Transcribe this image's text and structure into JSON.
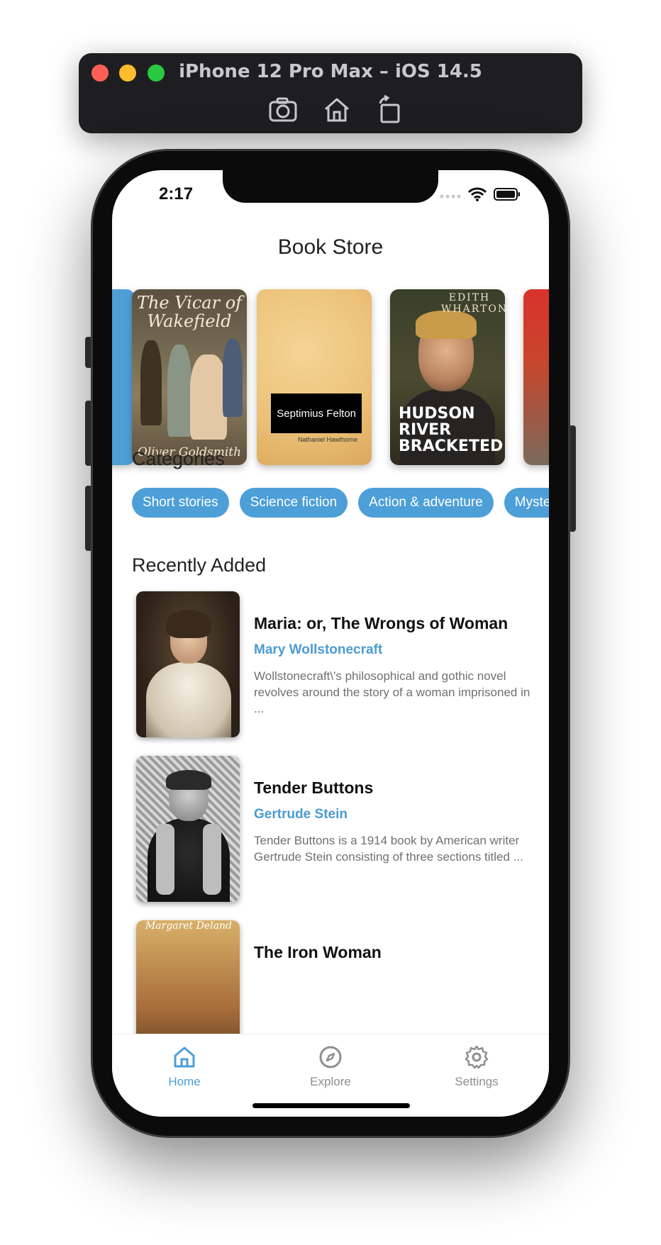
{
  "simulator": {
    "title": "iPhone 12 Pro Max – iOS 14.5",
    "tools": [
      "camera-icon",
      "home-icon",
      "rotate-icon"
    ]
  },
  "status_bar": {
    "time": "2:17"
  },
  "app": {
    "title": "Book Store"
  },
  "featured": [
    {
      "id": "vicar",
      "cover_title": "The Vicar of Wakefield",
      "cover_author": "Oliver Goldsmith"
    },
    {
      "id": "septimius",
      "cover_title": "Septimius Felton",
      "cover_author": "Nathaniel Hawthorne"
    },
    {
      "id": "hudson",
      "cover_author": "EDITH WHARTON",
      "cover_title": "HUDSON RIVER BRACKETED"
    }
  ],
  "categories": {
    "title": "Categories",
    "chips": [
      "Short stories",
      "Science fiction",
      "Action & adventure",
      "Myster"
    ]
  },
  "recent": {
    "title": "Recently Added",
    "books": [
      {
        "title": "Maria: or, The Wrongs of Woman",
        "author": "Mary Wollstonecraft",
        "description": "Wollstonecraft\\'s philosophical and gothic novel revolves around the story of a woman imprisoned in ..."
      },
      {
        "title": "Tender Buttons",
        "author": "Gertrude Stein",
        "description": "Tender Buttons is a 1914 book by American writer Gertrude Stein consisting of three sections titled ..."
      },
      {
        "title": "The Iron Woman",
        "cover_caption": "Margaret Deland"
      }
    ]
  },
  "tabs": [
    {
      "label": "Home",
      "icon": "home-icon",
      "active": true
    },
    {
      "label": "Explore",
      "icon": "compass-icon",
      "active": false
    },
    {
      "label": "Settings",
      "icon": "gear-icon",
      "active": false
    }
  ],
  "colors": {
    "accent": "#4d9fd8",
    "inactive": "#8e8e93",
    "simulator_bar": "#1e1e21"
  }
}
